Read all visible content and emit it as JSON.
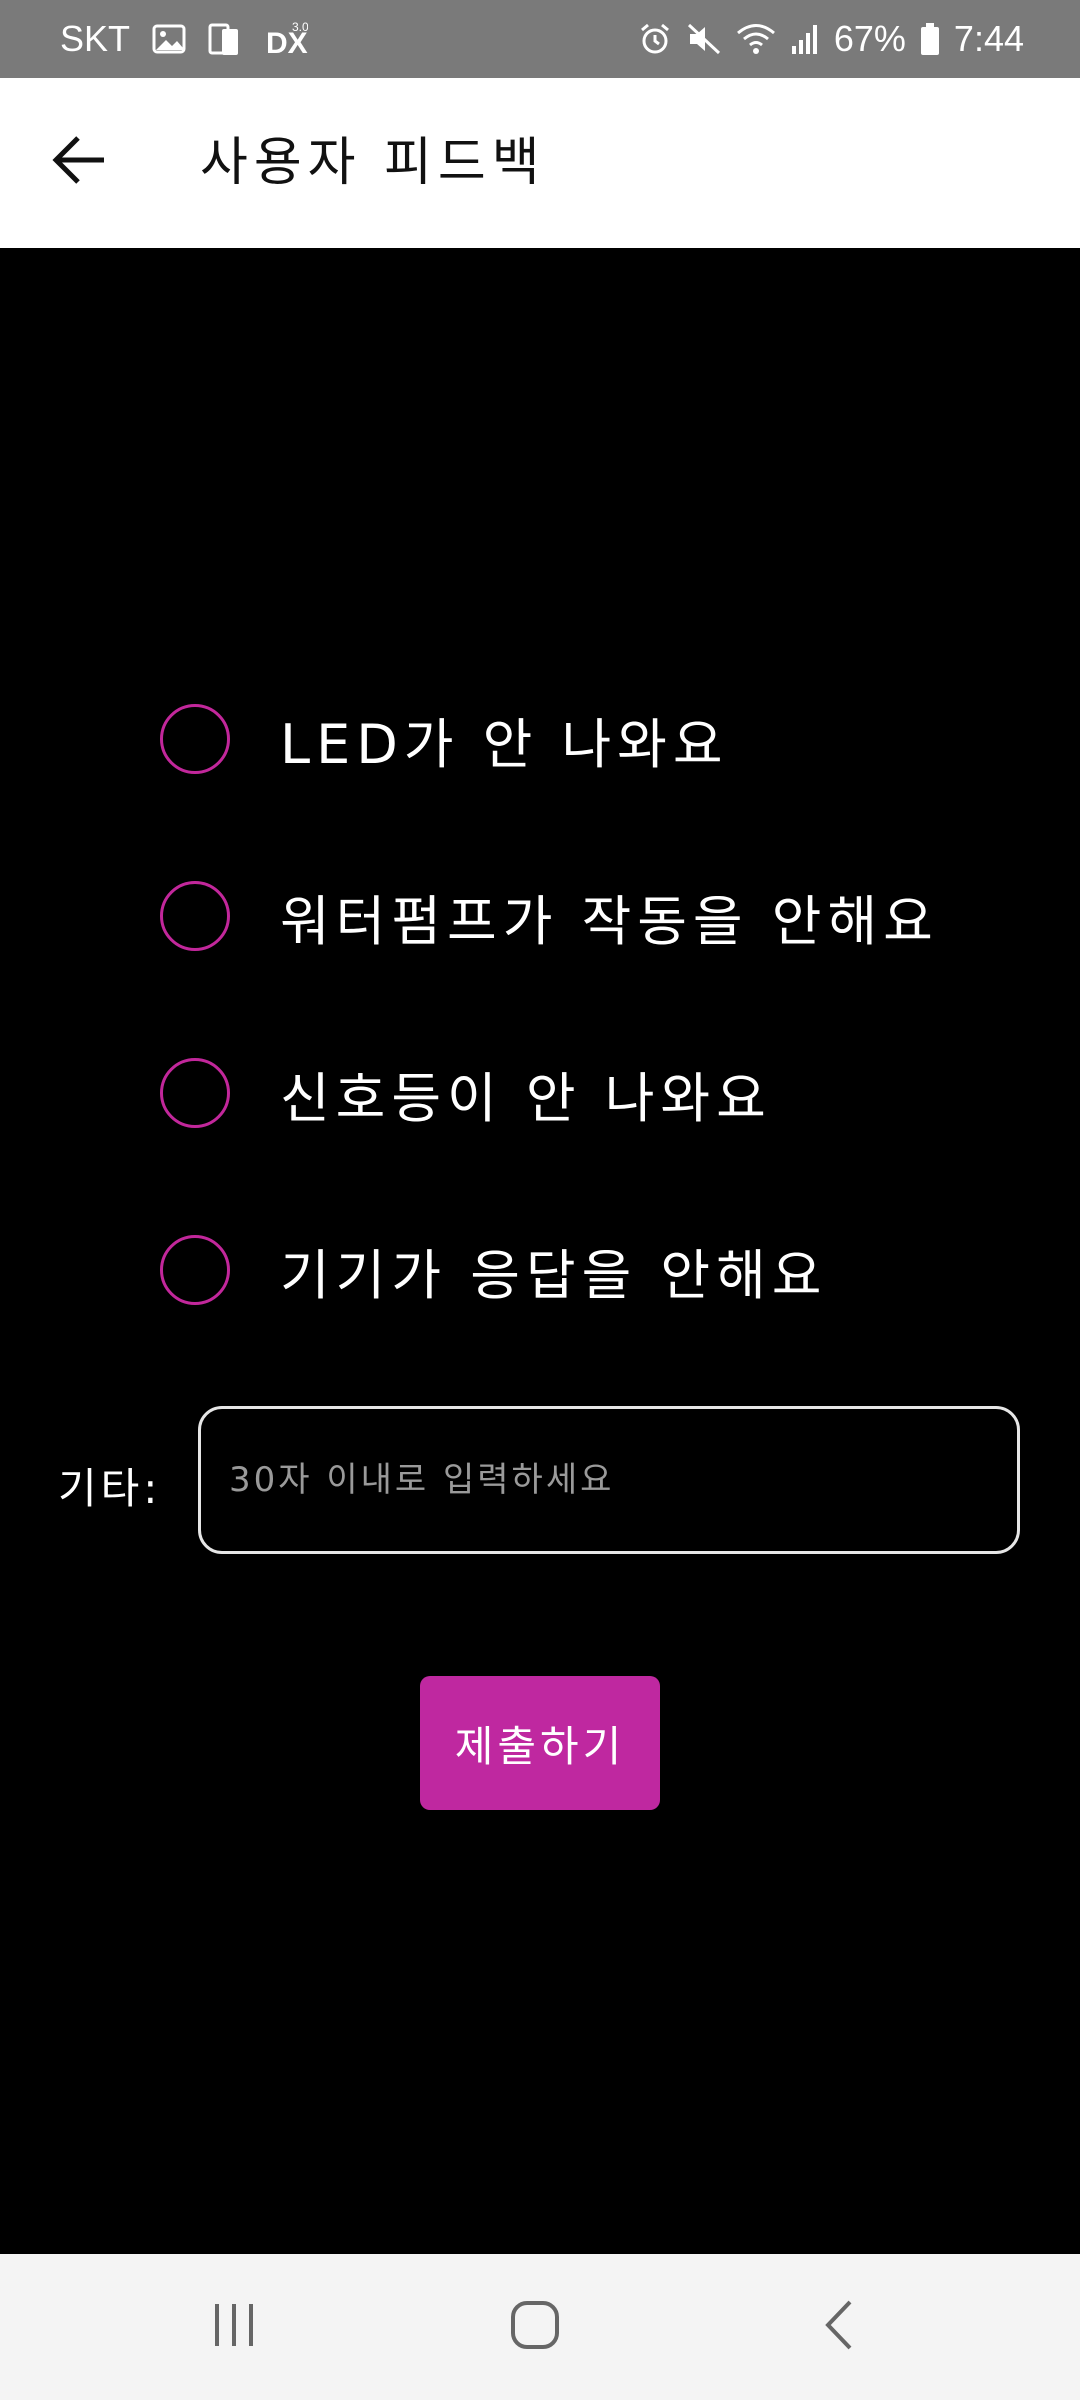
{
  "status_bar": {
    "carrier": "SKT",
    "battery": "67%",
    "time": "7:44",
    "left_icons": [
      "gallery-icon",
      "sim-icon",
      "dex-icon"
    ],
    "right_icons": [
      "alarm-icon",
      "mute-icon",
      "wifi-icon",
      "signal-icon",
      "battery-icon"
    ]
  },
  "app_bar": {
    "title": "사용자 피드백",
    "back_icon": "arrow-left-icon"
  },
  "feedback": {
    "options": [
      {
        "label": "LED가 안 나와요",
        "selected": false
      },
      {
        "label": "워터펌프가 작동을 안해요",
        "selected": false
      },
      {
        "label": "신호등이 안 나와요",
        "selected": false
      },
      {
        "label": "기기가 응답을 안해요",
        "selected": false
      }
    ],
    "other_label": "기타:",
    "other_placeholder": "30자 이내로 입력하세요",
    "other_value": "",
    "submit_label": "제출하기"
  },
  "colors": {
    "accent": "#bf28a0",
    "radio_border": "#c2279b",
    "background": "#000000",
    "app_bar": "#ffffff",
    "status_bar": "#7a7a7a"
  },
  "nav_bar": {
    "items": [
      "recent-apps-icon",
      "home-icon",
      "back-icon"
    ]
  }
}
